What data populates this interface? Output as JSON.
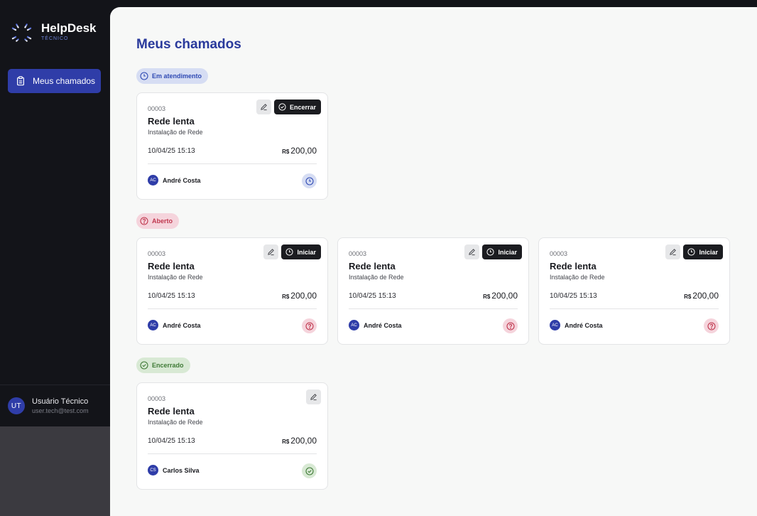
{
  "app": {
    "brand": "HelpDesk",
    "brand_sub": "TÉCNICO"
  },
  "sidebar": {
    "nav": [
      {
        "label": "Meus chamados",
        "icon": "clipboard-icon",
        "active": true
      }
    ],
    "user": {
      "initials": "UT",
      "name": "Usuário Técnico",
      "email": "user.tech@test.com"
    }
  },
  "page": {
    "title": "Meus chamados"
  },
  "sections": [
    {
      "status": "Em atendimento",
      "icon": "clock-icon",
      "color": "#2f4ab3",
      "tickets": [
        {
          "id": "00003",
          "title": "Rede lenta",
          "service": "Instalação de Rede",
          "date": "10/04/25 15:13",
          "currency": "R$",
          "price": "200,00",
          "client_initials": "AC",
          "client": "André Costa",
          "action": "Encerrar"
        }
      ]
    },
    {
      "status": "Aberto",
      "icon": "help-circle-icon",
      "color": "#c0384f",
      "tickets": [
        {
          "id": "00003",
          "title": "Rede lenta",
          "service": "Instalação de Rede",
          "date": "10/04/25 15:13",
          "currency": "R$",
          "price": "200,00",
          "client_initials": "AC",
          "client": "André Costa",
          "action": "Iniciar"
        },
        {
          "id": "00003",
          "title": "Rede lenta",
          "service": "Instalação de Rede",
          "date": "10/04/25 15:13",
          "currency": "R$",
          "price": "200,00",
          "client_initials": "AC",
          "client": "André Costa",
          "action": "Iniciar"
        },
        {
          "id": "00003",
          "title": "Rede lenta",
          "service": "Instalação de Rede",
          "date": "10/04/25 15:13",
          "currency": "R$",
          "price": "200,00",
          "client_initials": "AC",
          "client": "André Costa",
          "action": "Iniciar"
        }
      ]
    },
    {
      "status": "Encerrado",
      "icon": "check-circle-icon",
      "color": "#3f7a36",
      "tickets": [
        {
          "id": "00003",
          "title": "Rede lenta",
          "service": "Instalação de Rede",
          "date": "10/04/25 15:13",
          "currency": "R$",
          "price": "200,00",
          "client_initials": "CS",
          "client": "Carlos Silva",
          "action": ""
        }
      ]
    }
  ]
}
